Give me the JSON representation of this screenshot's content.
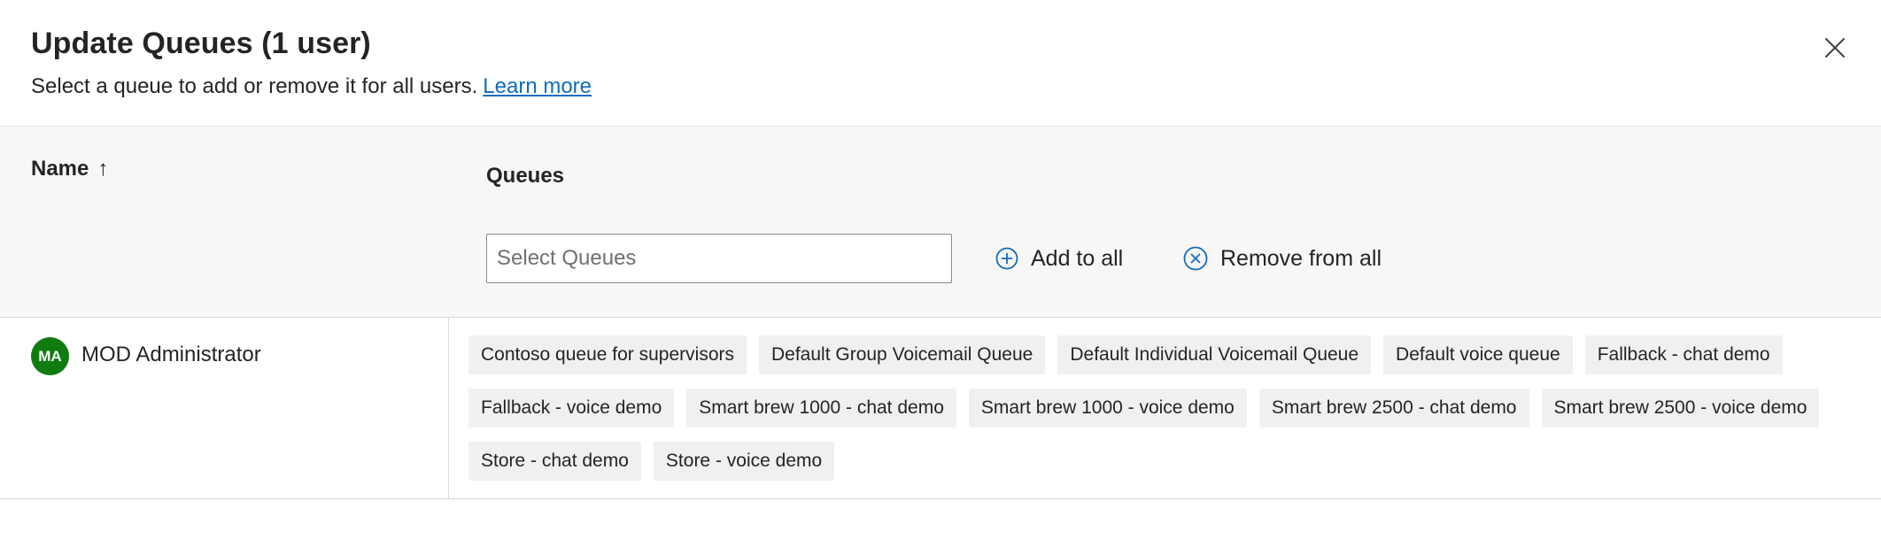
{
  "dialog": {
    "title": "Update Queues (1 user)",
    "subtitle": "Select a queue to add or remove it for all users.",
    "learn_more": "Learn more",
    "close_icon": "close-icon"
  },
  "table": {
    "col_name": "Name",
    "sort_arrow": "↑",
    "col_queues": "Queues",
    "select_placeholder": "Select Queues",
    "add_to_all": "Add to all",
    "add_icon": "add-circle-icon",
    "remove_from_all": "Remove from all",
    "remove_icon": "dismiss-circle-icon"
  },
  "rows": [
    {
      "initials": "MA",
      "name": "MOD Administrator",
      "avatar_color": "#107c10",
      "queue_lines": [
        [
          "Contoso queue for supervisors",
          "Default Group Voicemail Queue",
          "Default Individual Voicemail Queue",
          "Default voice queue",
          "Fallback - chat demo"
        ],
        [
          "Fallback - voice demo",
          "Smart brew 1000 - chat demo",
          "Smart brew 1000 - voice demo",
          "Smart brew 2500 - chat demo",
          "Smart brew 2500 - voice demo"
        ],
        [
          "Store - chat demo",
          "Store - voice demo"
        ]
      ]
    }
  ],
  "colors": {
    "link": "#0f6cbd",
    "header_bg": "#f8f7f6",
    "chip_bg": "#f0f0f0",
    "icon_accent": "#0f6cbd"
  }
}
